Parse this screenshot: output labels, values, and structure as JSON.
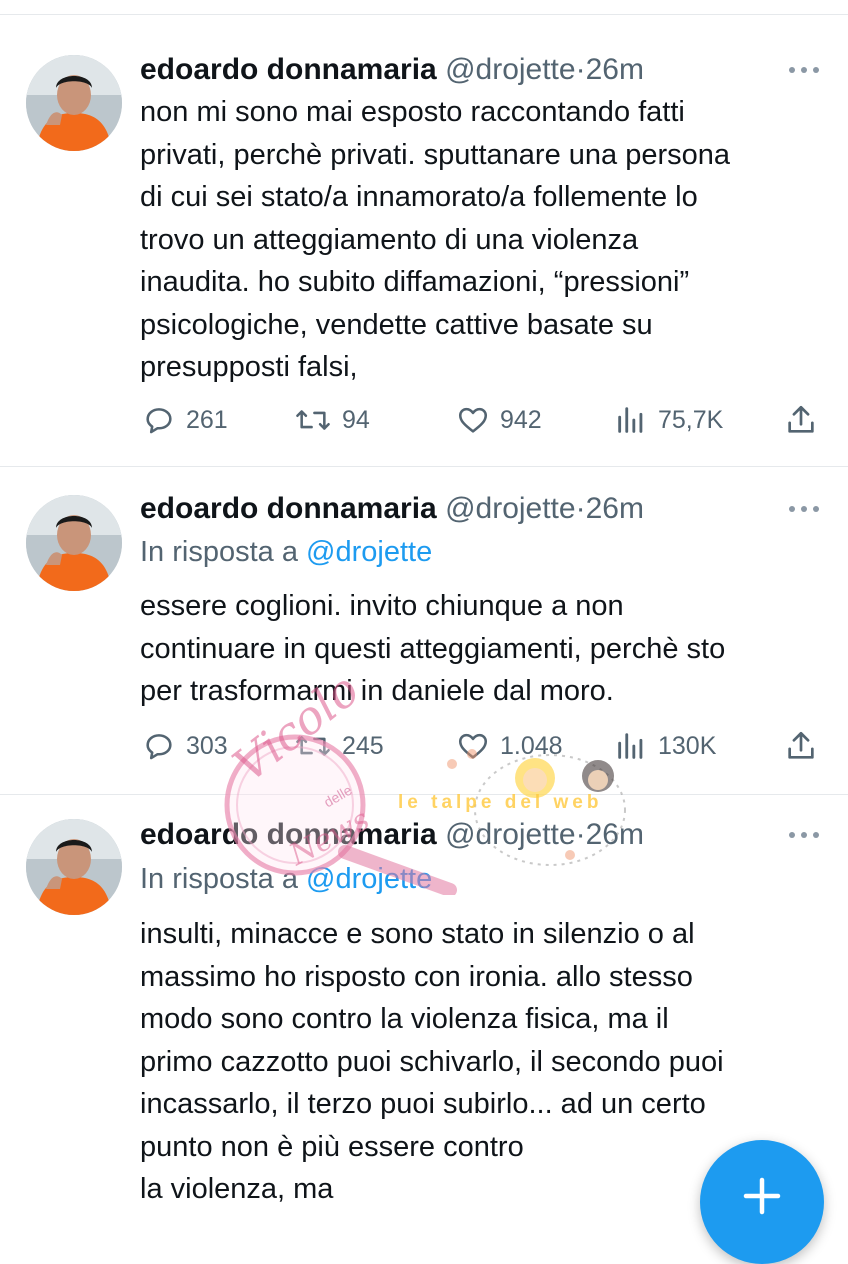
{
  "tweets": [
    {
      "name": "edoardo donnamaria",
      "handle": "@drojette",
      "separator": "·",
      "time": "26m",
      "reply_prefix": "",
      "reply_mention": "",
      "lines": [
        "non mi sono mai esposto raccontando fatti",
        "privati, perchè privati. sputtanare una persona",
        "di cui sei stato/a innamorato/a follemente lo",
        "trovo un atteggiamento di una violenza",
        "inaudita. ho subito diffamazioni, “pressioni”",
        "psicologiche, vendette cattive basate su",
        "presupposti falsi,"
      ],
      "replies": "261",
      "retweets": "94",
      "likes": "942",
      "views": "75,7K"
    },
    {
      "name": "edoardo donnamaria",
      "handle": "@drojette",
      "separator": "·",
      "time": "26m",
      "reply_prefix": "In risposta a ",
      "reply_mention": "@drojette",
      "lines": [
        "essere coglioni. invito chiunque a non",
        "continuare in questi atteggiamenti, perchè sto",
        "per trasformarmi in daniele dal moro."
      ],
      "replies": "303",
      "retweets": "245",
      "likes": "1.048",
      "views": "130K"
    },
    {
      "name": "edoardo donnamaria",
      "handle": "@drojette",
      "separator": "·",
      "time": "26m",
      "reply_prefix": "In risposta a ",
      "reply_mention": "@drojette",
      "lines": [
        "insulti, minacce e sono stato in silenzio o al",
        "massimo ho risposto con ironia. allo stesso",
        "modo sono contro la violenza fisica, ma il",
        "primo cazzotto puoi schivarlo, il secondo puoi",
        "incassarlo, il terzo puoi subirlo... ad un certo",
        "punto non è più essere contro",
        "la violenza, ma"
      ]
    }
  ],
  "watermark": {
    "left_script": "Vicolo",
    "left_small": "delle",
    "left_bottom": "News",
    "right_banner": "le talpe del web"
  },
  "icons": {
    "more": "more-horizontal-icon",
    "reply": "reply-bubble-icon",
    "retweet": "retweet-icon",
    "like": "heart-icon",
    "views": "views-bar-chart-icon",
    "share": "share-icon",
    "compose": "compose-plus-icon"
  },
  "colors": {
    "accent": "#1d9bf0",
    "text": "#0f1419",
    "secondary": "#536471",
    "divider": "#e6e9ec"
  }
}
